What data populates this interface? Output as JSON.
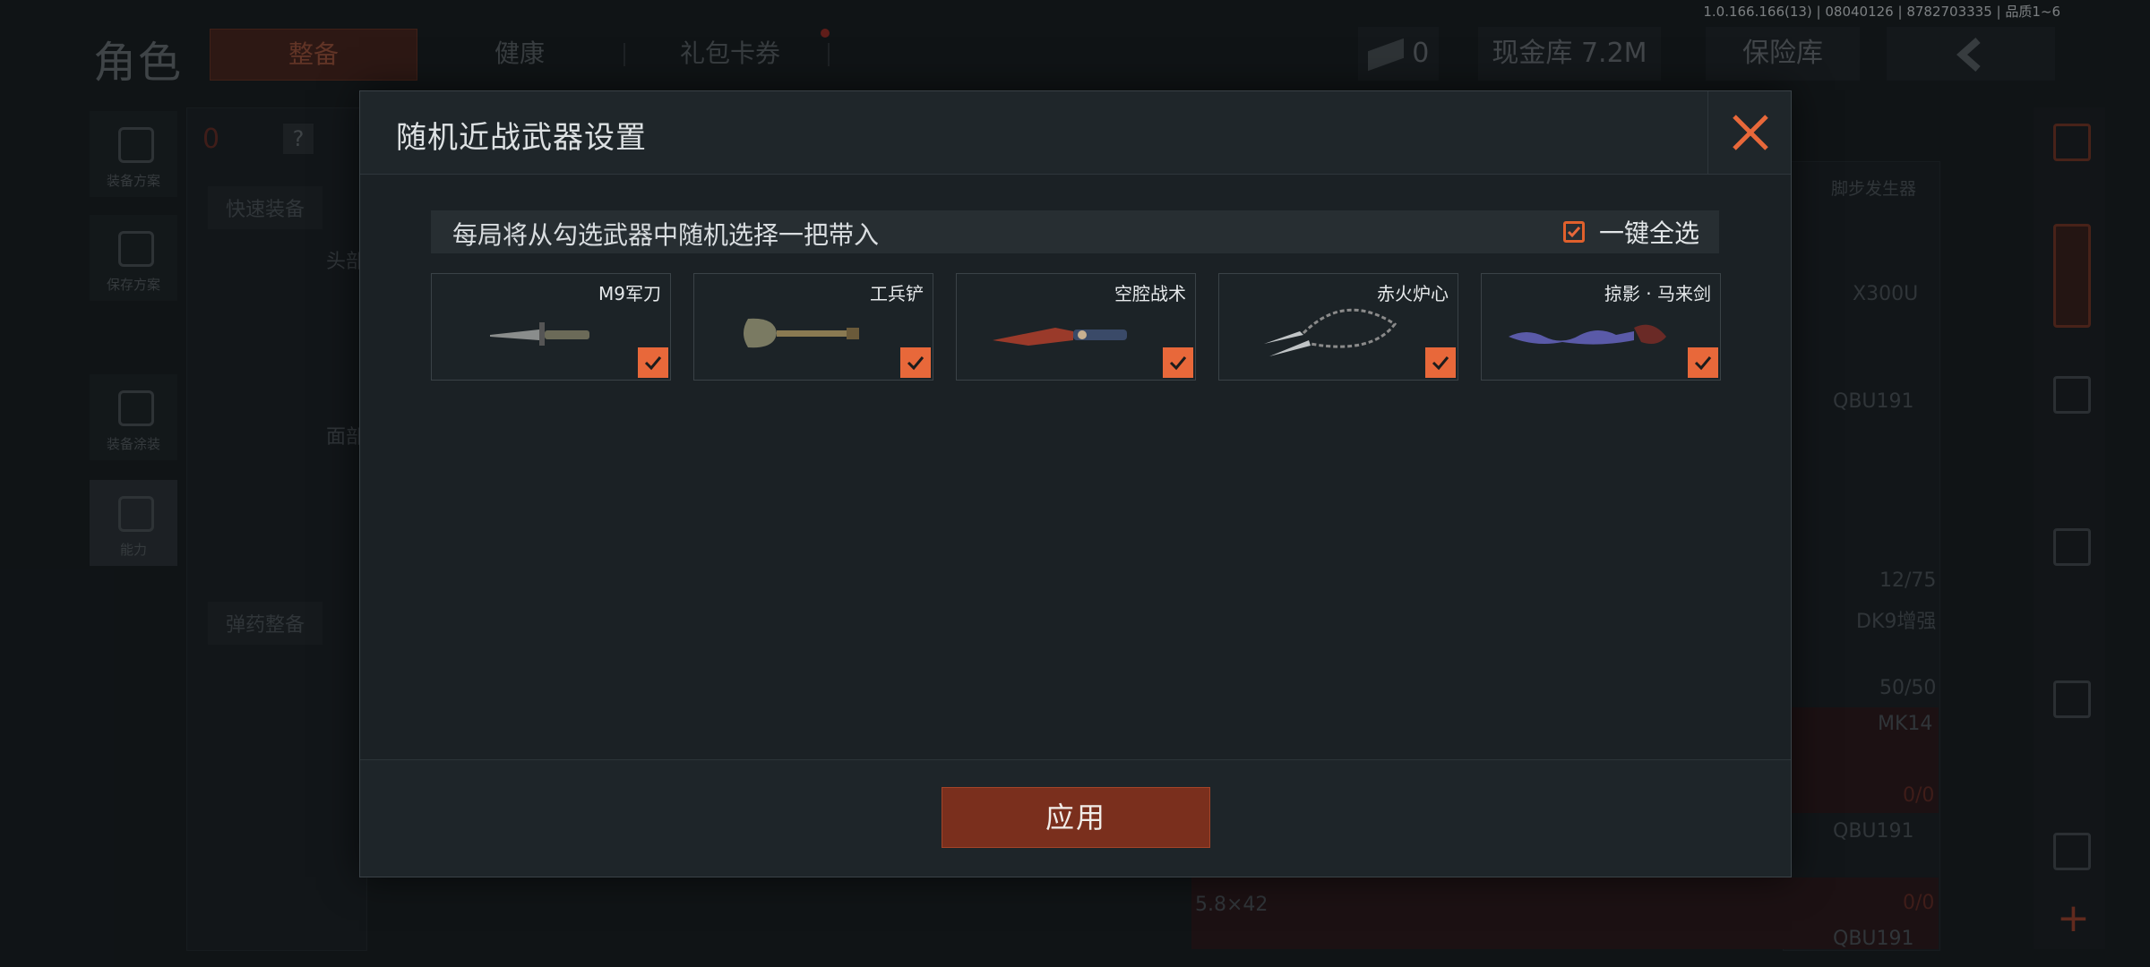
{
  "version_info": "1.0.166.166(13) | 08040126 | 8782703335 | 品质1~6",
  "background": {
    "page_title": "角色",
    "tabs": [
      {
        "label": "整备",
        "active": true
      },
      {
        "label": "健康",
        "active": false
      },
      {
        "label": "礼包卡券",
        "active": false
      }
    ],
    "ticket_count": "0",
    "cash_vault": "现金库 7.2M",
    "insurance_vault": "保险库",
    "left_rail": [
      {
        "label": "装备方案"
      },
      {
        "label": "保存方案"
      },
      {
        "label": "装备涂装"
      },
      {
        "label": "能力"
      }
    ],
    "armor_count": "0",
    "help_label": "?",
    "quick_equip": "快速装备",
    "head_label": "头部",
    "face_label": "面部",
    "ammo_equip": "弹药整备",
    "right_items": [
      {
        "label": "脚步发生器"
      },
      {
        "label": "X300U"
      },
      {
        "label": "QBU191"
      },
      {
        "label": "12/75"
      },
      {
        "label": "DK9增强"
      },
      {
        "label": "50/50"
      },
      {
        "label": "MK14"
      },
      {
        "label": "0/0"
      },
      {
        "label": "QBU191"
      },
      {
        "label": "0/0"
      },
      {
        "label": "QBU191"
      }
    ],
    "ammo_caliber": "5.8×42"
  },
  "modal": {
    "title": "随机近战武器设置",
    "info_text": "每局将从勾选武器中随机选择一把带入",
    "select_all_label": "一键全选",
    "select_all_checked": true,
    "weapons": [
      {
        "name": "M9军刀",
        "checked": true,
        "icon": "combat-knife-icon"
      },
      {
        "name": "工兵铲",
        "checked": true,
        "icon": "shovel-icon"
      },
      {
        "name": "空腔战术",
        "checked": true,
        "icon": "tactical-knife-icon"
      },
      {
        "name": "赤火炉心",
        "checked": true,
        "icon": "kunai-pair-icon"
      },
      {
        "name": "掠影 · 马来剑",
        "checked": true,
        "icon": "kris-sword-icon"
      }
    ],
    "apply_label": "应用"
  },
  "colors": {
    "accent": "#e8683a",
    "apply_button": "#7a2f1d"
  }
}
